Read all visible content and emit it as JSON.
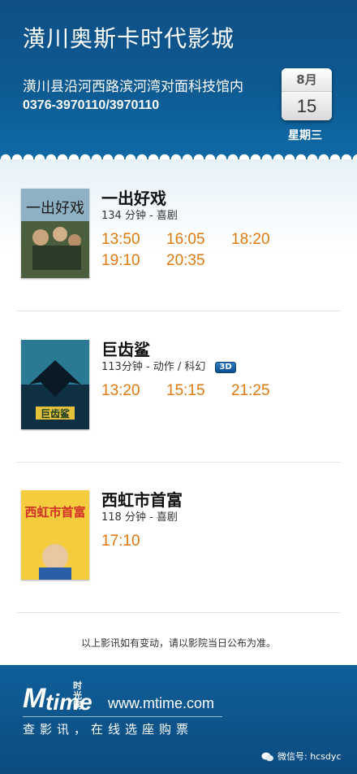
{
  "header": {
    "cinema_name": "潢川奥斯卡时代影城",
    "address": "潢川县沿河西路滨河湾对面科技馆内",
    "phone": "0376-3970110/3970110",
    "calendar": {
      "month": "8月",
      "day": "15"
    },
    "weekday": "星期三"
  },
  "movies": [
    {
      "title": "一出好戏",
      "info": "134 分钟 - 喜剧",
      "format": "",
      "times": [
        "13:50",
        "16:05",
        "18:20",
        "19:10",
        "20:35"
      ],
      "poster_colors": [
        "#7a9cb0",
        "#3f5a3a"
      ]
    },
    {
      "title": "巨齿鲨",
      "info": "113分钟 - 动作 / 科幻",
      "format": "3D",
      "times": [
        "13:20",
        "15:15",
        "21:25"
      ],
      "poster_colors": [
        "#1f5f78",
        "#0b1f2e"
      ]
    },
    {
      "title": "西虹市首富",
      "info": "118 分钟 - 喜剧",
      "format": "",
      "times": [
        "17:10"
      ],
      "poster_colors": [
        "#f2c640",
        "#d83a2a"
      ]
    }
  ],
  "notice": "以上影讯如有变动，请以影院当日公布为准。",
  "footer": {
    "logo_m": "M",
    "logo_time": "time",
    "logo_cn": "时光网",
    "url": "www.mtime.com",
    "slogan": "查影讯，在线选座购票",
    "wechat": "微信号: hcsdyc"
  },
  "colors": {
    "header_blue": "#0d5a92",
    "showtime_orange": "#e07a10",
    "footer_blue": "#0b4c80"
  }
}
